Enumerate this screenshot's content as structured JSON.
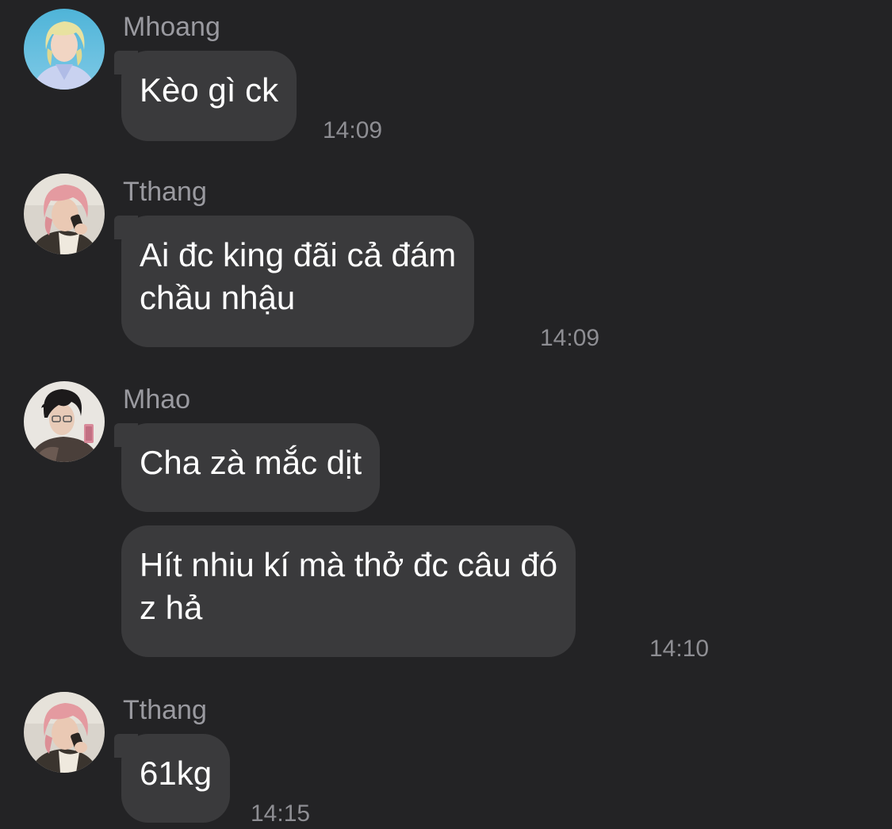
{
  "messages": [
    {
      "sender": "Mhoang",
      "avatar_icon": "avatar-blonde-hair-photo-icon",
      "bubbles": [
        {
          "lines": [
            "Kèo gì ck"
          ]
        }
      ],
      "time": "14:09"
    },
    {
      "sender": "Tthang",
      "avatar_icon": "avatar-pink-hair-phone-photo-icon",
      "bubbles": [
        {
          "lines": [
            "Ai đc king đãi cả đám",
            "chầu nhậu"
          ]
        }
      ],
      "time": "14:09"
    },
    {
      "sender": "Mhao",
      "avatar_icon": "avatar-dark-hair-selfie-photo-icon",
      "bubbles": [
        {
          "lines": [
            "Cha zà mắc dịt"
          ]
        },
        {
          "lines": [
            "Hít nhiu kí mà thở đc câu đó",
            "z hả"
          ]
        }
      ],
      "time": "14:10"
    },
    {
      "sender": "Tthang",
      "avatar_icon": "avatar-pink-hair-phone-photo-icon",
      "bubbles": [
        {
          "lines": [
            "61kg"
          ]
        }
      ],
      "time": "14:15"
    }
  ],
  "colors": {
    "background": "#232325",
    "bubble": "#3a3a3c",
    "sender_name": "#9a9aa0",
    "timestamp": "#8e8e93",
    "message_text": "#ffffff"
  }
}
